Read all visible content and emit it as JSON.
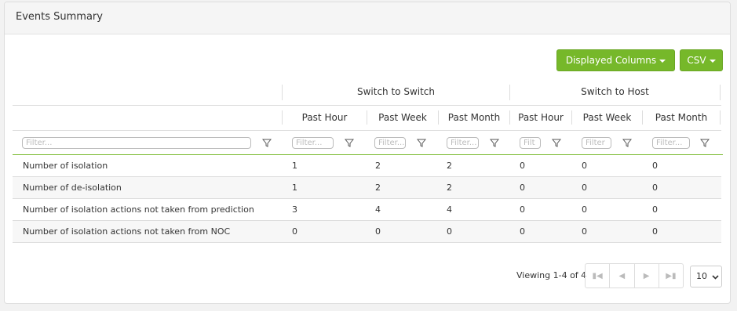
{
  "panel": {
    "title": "Events Summary"
  },
  "toolbar": {
    "displayed_columns_label": "Displayed Columns",
    "csv_label": "CSV"
  },
  "table": {
    "group_headers": [
      "Switch to Switch",
      "Switch to Host"
    ],
    "columns": [
      "Past Hour",
      "Past Week",
      "Past Month",
      "Past Hour",
      "Past Week",
      "Past Month"
    ],
    "filter_placeholders": [
      "Filter...",
      "Filter...",
      "Filter...",
      "Filter...",
      "Filt",
      "Filter",
      "Filter..."
    ],
    "rows": [
      {
        "label": "Number of isolation",
        "values": [
          "1",
          "2",
          "2",
          "0",
          "0",
          "0"
        ]
      },
      {
        "label": "Number of de-isolation",
        "values": [
          "1",
          "2",
          "2",
          "0",
          "0",
          "0"
        ]
      },
      {
        "label": "Number of isolation actions not taken from prediction",
        "values": [
          "3",
          "4",
          "4",
          "0",
          "0",
          "0"
        ]
      },
      {
        "label": "Number of isolation actions not taken from NOC",
        "values": [
          "0",
          "0",
          "0",
          "0",
          "0",
          "0"
        ]
      }
    ]
  },
  "pager": {
    "viewing_text": "Viewing 1-4 of 4",
    "page_size": "10"
  },
  "colors": {
    "accent": "#76b82a"
  },
  "icons": [
    "filter-icon",
    "first-page-icon",
    "prev-page-icon",
    "next-page-icon",
    "last-page-icon",
    "chevron-down-icon"
  ]
}
